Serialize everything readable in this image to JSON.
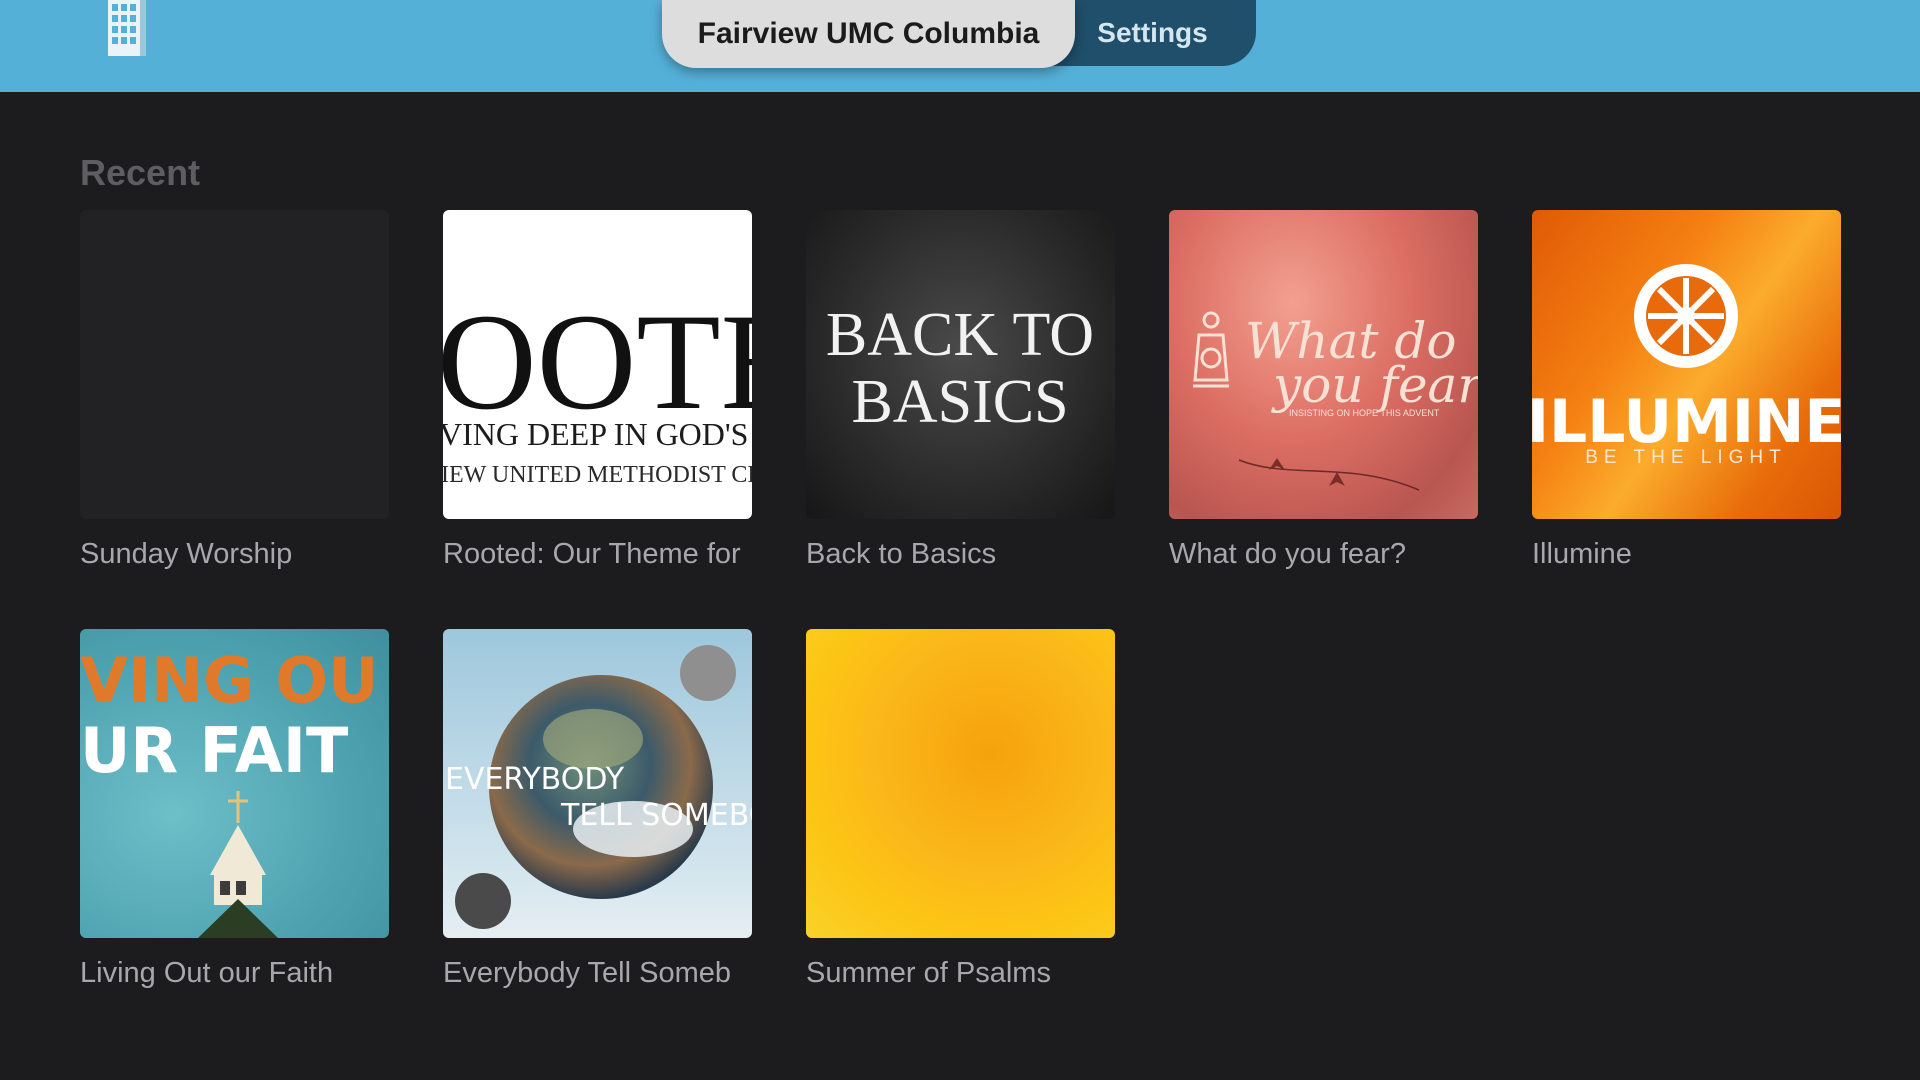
{
  "nav": {
    "tabs": [
      {
        "label": "Fairview UMC Columbia",
        "active": true
      },
      {
        "label": "Settings",
        "active": false
      }
    ],
    "logo_icon": "church-window-logo-icon"
  },
  "section": {
    "title": "Recent"
  },
  "items": [
    {
      "label": "Sunday Worship",
      "artwork": "blank"
    },
    {
      "label": "Rooted: Our Theme for",
      "artwork_lines": [
        "OOTE",
        "VING DEEP IN GOD'S W",
        "IEW UNITED METHODIST CH"
      ]
    },
    {
      "label": "Back to Basics",
      "artwork_lines": [
        "BACK TO",
        "BASICS"
      ]
    },
    {
      "label": "What do you fear?",
      "artwork_lines": [
        "What do",
        "you fear",
        "INSISTING ON HOPE THIS ADVENT"
      ]
    },
    {
      "label": "Illumine",
      "artwork_lines": [
        "ILLUMINE",
        "BE THE LIGHT"
      ]
    },
    {
      "label": "Living Out our Faith",
      "artwork_lines": [
        "VING OU",
        "UR FAIT"
      ]
    },
    {
      "label": "Everybody Tell Someb",
      "artwork_lines": [
        "EVERYBODY",
        "TELL SOMEBODY"
      ]
    },
    {
      "label": "Summer of Psalms",
      "artwork": "yellow-watercolor"
    }
  ],
  "colors": {
    "topbar": "#55b0d8",
    "background": "#1c1c1e",
    "active_tab": "#ddddde",
    "nav_pill": "#1f4f6a"
  }
}
